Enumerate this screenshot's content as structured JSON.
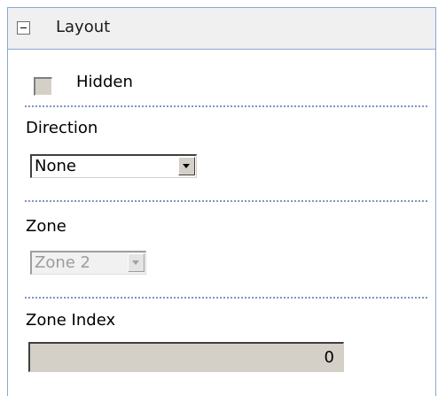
{
  "section": {
    "title": "Layout",
    "expanded": true
  },
  "hidden": {
    "label": "Hidden",
    "checked": false
  },
  "direction": {
    "label": "Direction",
    "value": "None"
  },
  "zone": {
    "label": "Zone",
    "value": "Zone 2",
    "disabled": true
  },
  "zone_index": {
    "label": "Zone Index",
    "value": "0"
  },
  "colors": {
    "border": "#8aa7d6",
    "divider": "#7b96c4",
    "header_bg": "#f0f0f0",
    "control_bg": "#d4d0c8"
  },
  "icons": {
    "collapse": "minus-box-icon",
    "dropdown": "chevron-down-icon"
  }
}
